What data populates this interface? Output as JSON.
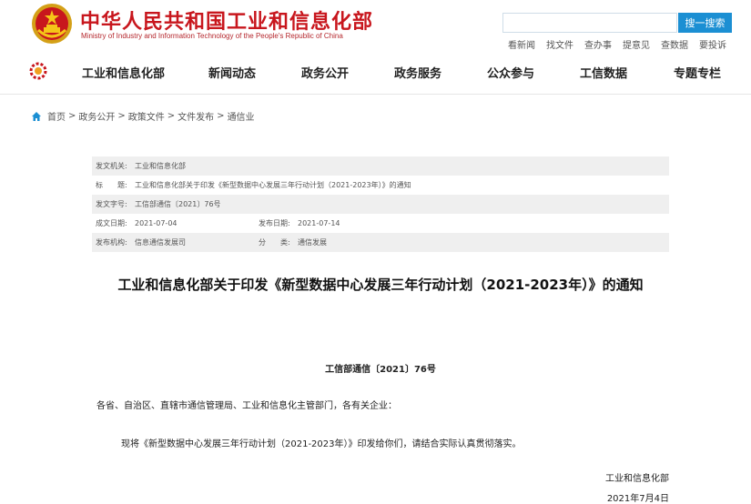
{
  "header": {
    "title": "中华人民共和国工业和信息化部",
    "subtitle": "Ministry of Industry and Information Technology of the People's Republic of China",
    "search": {
      "placeholder": "",
      "button_label": "搜一搜索"
    },
    "quick_links": [
      "看新闻",
      "找文件",
      "查办事",
      "提意见",
      "查数据",
      "要投诉"
    ]
  },
  "nav": {
    "items": [
      "工业和信息化部",
      "新闻动态",
      "政务公开",
      "政务服务",
      "公众参与",
      "工信数据",
      "专题专栏"
    ]
  },
  "breadcrumb": [
    "首页",
    "政务公开",
    "政策文件",
    "文件发布",
    "通信业"
  ],
  "meta": {
    "issuer_label": "发文机关:",
    "issuer": "工业和信息化部",
    "title_label": "标　　题:",
    "title": "工业和信息化部关于印发《新型数据中心发展三年行动计划（2021-2023年）》的通知",
    "doc_no_label": "发文字号:",
    "doc_no": "工信部通信〔2021〕76号",
    "created_label": "成文日期:",
    "created": "2021-07-04",
    "published_label": "发布日期:",
    "published": "2021-07-14",
    "agency_label": "发布机构:",
    "agency": "信息通信发展司",
    "category_label": "分　　类:",
    "category": "通信发展"
  },
  "document": {
    "title": "工业和信息化部关于印发《新型数据中心发展三年行动计划（2021-2023年）》的通知",
    "number": "工信部通信〔2021〕76号",
    "recipients": "各省、自治区、直辖市通信管理局、工业和信息化主管部门，各有关企业：",
    "body": "现将《新型数据中心发展三年行动计划（2021-2023年）》印发给你们，请结合实际认真贯彻落实。",
    "signature": "工业和信息化部",
    "date": "2021年7月4日"
  },
  "colors": {
    "brand_red": "#c8161d",
    "accent_blue": "#1b8fd3"
  }
}
